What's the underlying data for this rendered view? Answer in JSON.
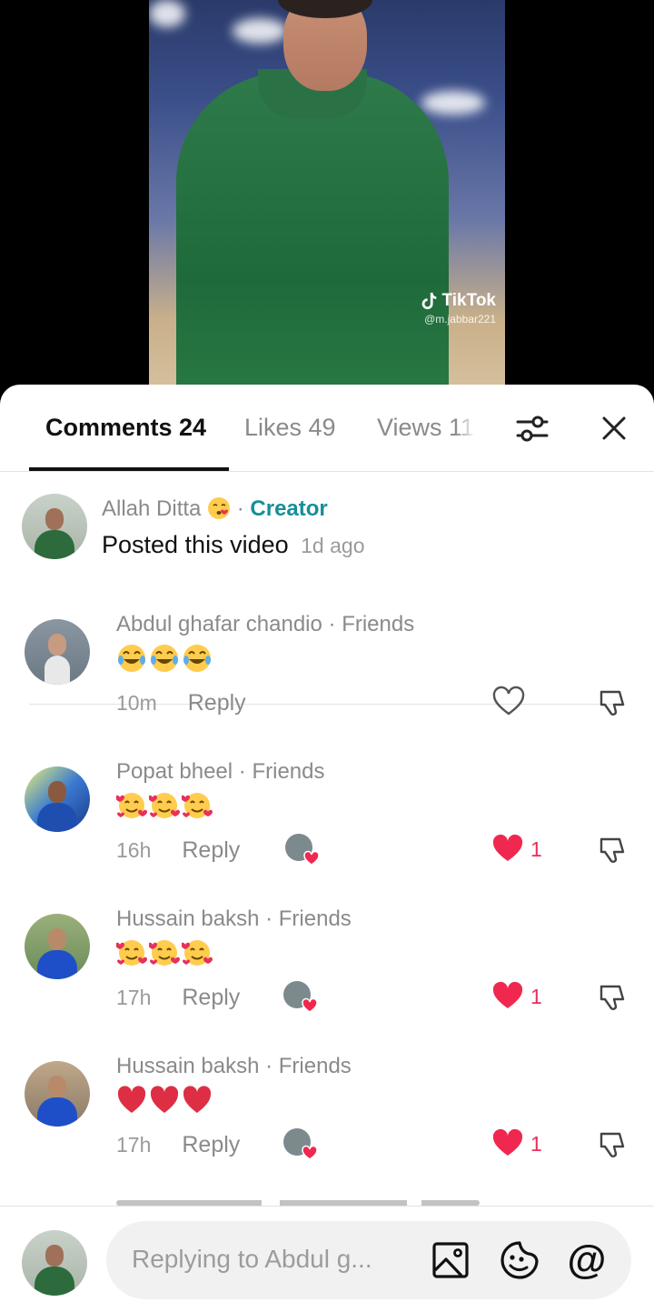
{
  "video": {
    "watermark_brand": "TikTok",
    "watermark_handle": "@m.jabbar221"
  },
  "tabs": {
    "comments": "Comments 24",
    "likes": "Likes 49",
    "views": "Views 11"
  },
  "creator_post": {
    "name": "Allah Ditta",
    "name_emoji": "kissing-face-emoji",
    "separator": "·",
    "tag": "Creator",
    "text": "Posted this video",
    "time": "1d ago"
  },
  "comments": [
    {
      "name": "Abdul ghafar chandio",
      "relation": "Friends",
      "emojis": [
        "tears-of-joy",
        "tears-of-joy",
        "tears-of-joy"
      ],
      "time": "10m",
      "reply": "Reply",
      "liked_by_creator": false,
      "liked": false,
      "like_count": ""
    },
    {
      "name": "Popat bheel",
      "relation": "Friends",
      "emojis": [
        "smiling-face-with-hearts",
        "smiling-face-with-hearts",
        "smiling-face-with-hearts"
      ],
      "time": "16h",
      "reply": "Reply",
      "liked_by_creator": true,
      "liked": true,
      "like_count": "1"
    },
    {
      "name": "Hussain baksh",
      "relation": "Friends",
      "emojis": [
        "smiling-face-with-hearts",
        "smiling-face-with-hearts",
        "smiling-face-with-hearts"
      ],
      "time": "17h",
      "reply": "Reply",
      "liked_by_creator": true,
      "liked": true,
      "like_count": "1"
    },
    {
      "name": "Hussain baksh",
      "relation": "Friends",
      "emojis": [
        "red-heart",
        "red-heart",
        "red-heart"
      ],
      "time": "17h",
      "reply": "Reply",
      "liked_by_creator": true,
      "liked": true,
      "like_count": "1"
    }
  ],
  "input": {
    "placeholder": "Replying to Abdul g..."
  },
  "colors": {
    "creator_tag": "#178e99",
    "like_red": "#e8305c",
    "heart_red": "#f02850"
  }
}
